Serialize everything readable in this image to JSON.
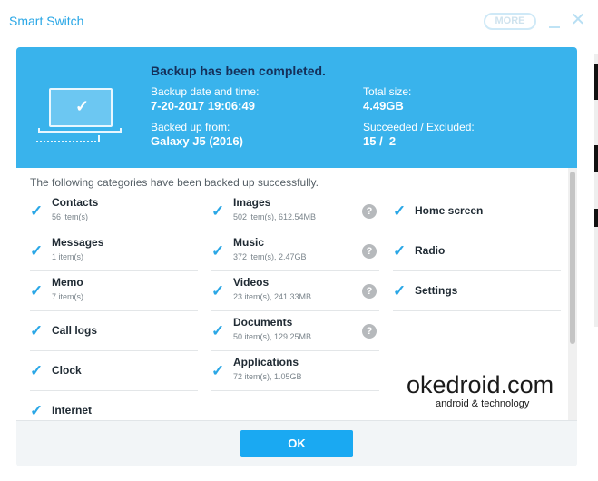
{
  "window": {
    "title": "Smart Switch",
    "more_label": "MORE",
    "close_glyph": "✕"
  },
  "banner": {
    "heading": "Backup has been completed.",
    "date_label": "Backup date and time:",
    "date_value": "7-20-2017 19:06:49",
    "device_label": "Backed up from:",
    "device_value": "Galaxy J5 (2016)",
    "size_label": "Total size:",
    "size_value": "4.49GB",
    "result_label": "Succeeded / Excluded:",
    "result_value": "15 /  2",
    "icon": "laptop-check-icon"
  },
  "content": {
    "intro": "The following categories have been backed up successfully.",
    "check_glyph": "✓",
    "help_glyph": "?",
    "col1": [
      {
        "name": "Contacts",
        "detail": "56 item(s)"
      },
      {
        "name": "Messages",
        "detail": "1 item(s)"
      },
      {
        "name": "Memo",
        "detail": "7 item(s)"
      },
      {
        "name": "Call logs",
        "detail": ""
      },
      {
        "name": "Clock",
        "detail": ""
      },
      {
        "name": "Internet",
        "detail": ""
      }
    ],
    "col2": [
      {
        "name": "Images",
        "detail": "502 item(s), 612.54MB"
      },
      {
        "name": "Music",
        "detail": "372 item(s), 2.47GB"
      },
      {
        "name": "Videos",
        "detail": "23 item(s), 241.33MB"
      },
      {
        "name": "Documents",
        "detail": "50 item(s), 129.25MB"
      },
      {
        "name": "Applications",
        "detail": "72 item(s), 1.05GB"
      }
    ],
    "col3": [
      {
        "name": "Home screen"
      },
      {
        "name": "Radio"
      },
      {
        "name": "Settings"
      }
    ]
  },
  "watermark": {
    "main": "okedroid.com",
    "sub": "android & technology"
  },
  "footer": {
    "ok_label": "OK"
  },
  "colors": {
    "accent": "#39b3ec",
    "button": "#1aa9f2",
    "check": "#2aa7e6"
  }
}
